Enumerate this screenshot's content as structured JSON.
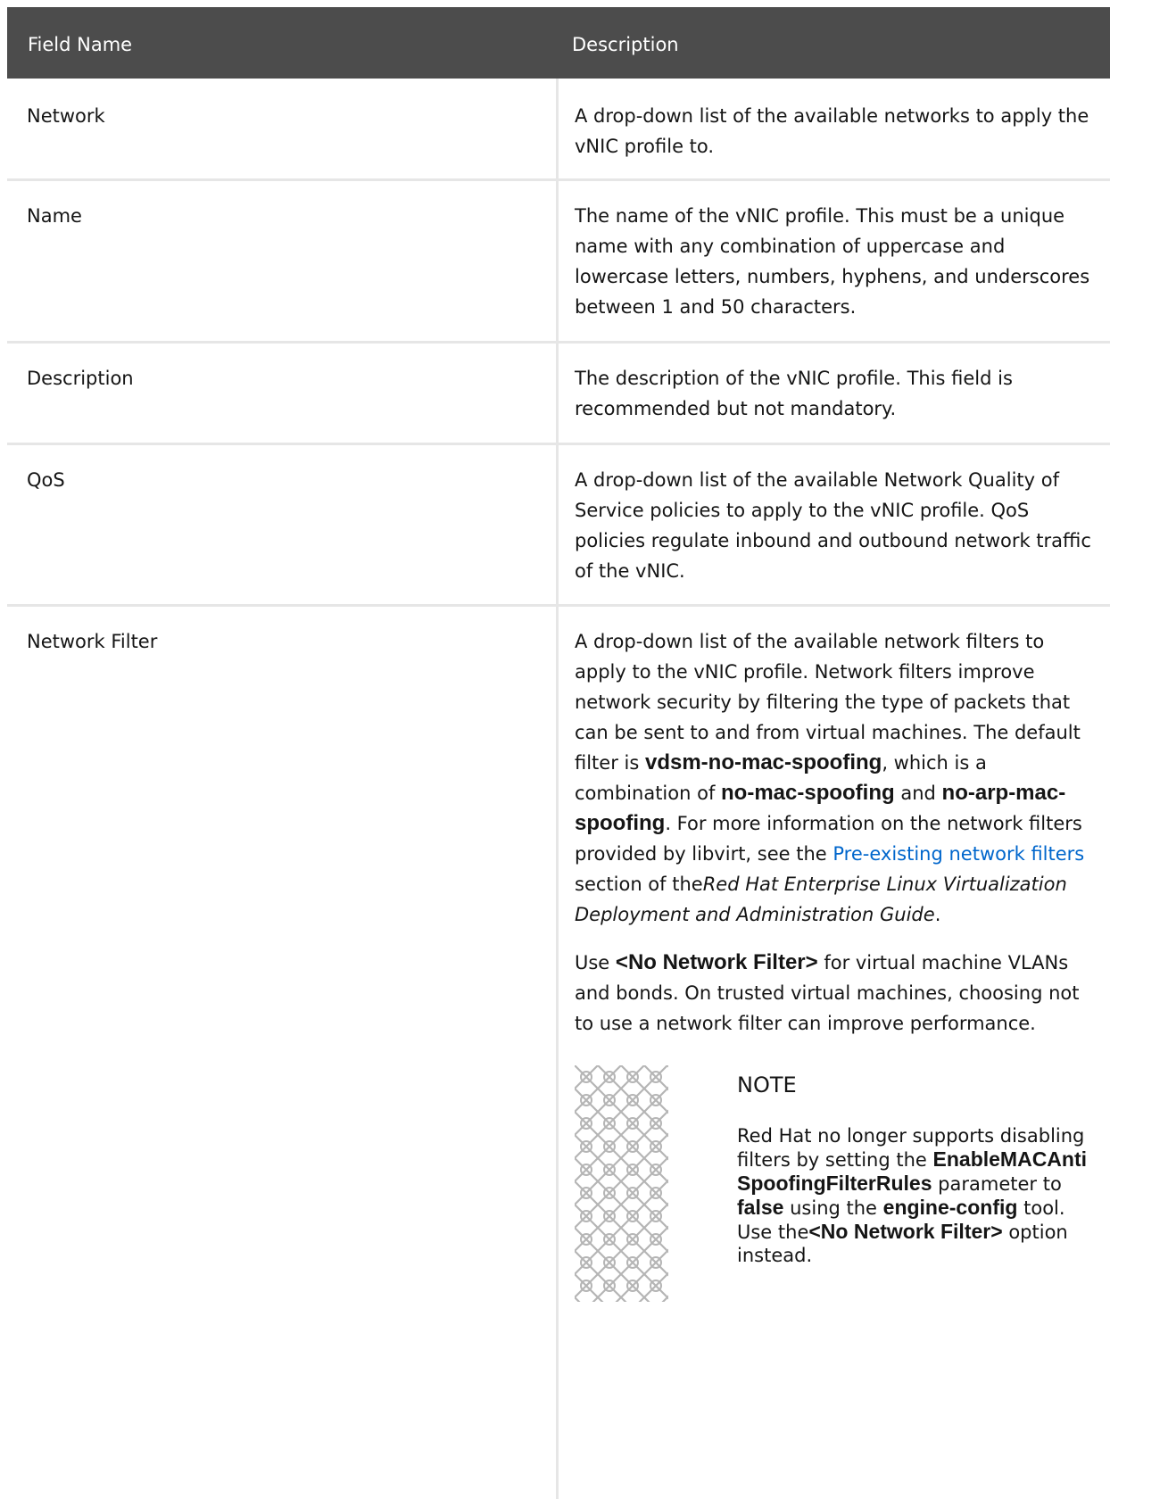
{
  "table": {
    "headers": [
      "Field Name",
      "Description"
    ],
    "rows": [
      {
        "field": "Network",
        "description": "A drop-down list of the available networks to apply the vNIC profile to."
      },
      {
        "field": "Name",
        "description": "The name of the vNIC profile. This must be a unique name with any combination of uppercase and lowercase letters, numbers, hyphens, and underscores between 1 and 50 characters."
      },
      {
        "field": "Description",
        "description": "The description of the vNIC profile. This field is recommended but not mandatory."
      },
      {
        "field": "QoS",
        "description": "A drop-down list of the available Network Quality of Service policies to apply to the vNIC profile. QoS policies regulate inbound and outbound network traffic of the vNIC."
      },
      {
        "field": "Network Filter"
      }
    ]
  },
  "network_filter": {
    "p1_a": "A drop-down list of the available network filters to apply to the vNIC profile. Network filters improve network security by filtering the type of packets that can be sent to and from virtual machines. The default filter is ",
    "p1_b1": "vdsm-no-mac-spoofing",
    "p1_c": ", which is a combination of ",
    "p1_b2": "no-mac-spoofing",
    "p1_d": " and ",
    "p1_b3": "no-arp-mac-spoofing",
    "p1_e": ". For more information on the network filters provided by libvirt, see the ",
    "p1_link": "Pre-existing network filters",
    "p1_f": " section of the",
    "p1_italic": "Red Hat Enterprise Linux Virtualization Deployment and Administration Guide",
    "p1_g": ".",
    "p2_a": "Use ",
    "p2_b": "<No Network Filter>",
    "p2_c": " for virtual machine VLANs and bonds. On trusted virtual machines, choosing not to use a network filter can improve performance.",
    "note": {
      "title": "NOTE",
      "t1": "Red Hat no longer supports disabling filters by setting the ",
      "b1": "EnableMACAntiSpoofingFilterRules",
      "t2": " parameter to ",
      "b2": "false",
      "t3": " using the ",
      "b3": "engine-config",
      "t4": " tool. Use the",
      "b4": "<No Network Filter>",
      "t5": " option instead."
    }
  },
  "colors": {
    "header_bg": "#4c4c4c",
    "border": "#e6e6e6",
    "link": "#0066cc",
    "note_icon": "#b5b5b5"
  }
}
